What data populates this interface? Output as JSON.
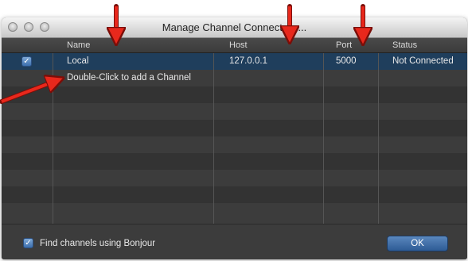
{
  "window": {
    "title": "Manage Channel Connect  s..."
  },
  "table": {
    "columns": {
      "name": "Name",
      "host": "Host",
      "port": "Port",
      "status": "Status"
    },
    "rows": [
      {
        "checked": "✓",
        "name": "Local",
        "host": "127.0.0.1",
        "port": "5000",
        "status": "Not Connected"
      },
      {
        "name": "Double-Click to add a Channel"
      }
    ]
  },
  "footer": {
    "bonjour_checked": "✓",
    "bonjour_label": "Find channels using Bonjour",
    "ok_label": "OK"
  },
  "colors": {
    "annotation_arrow": "#e8281c",
    "selected_row": "#1f3e5c",
    "ok_button": "#3a6aa6"
  },
  "icons": [
    "checkbox-icon",
    "close-traffic-light-icon",
    "minimize-traffic-light-icon",
    "zoom-traffic-light-icon",
    "annotation-arrow-icon"
  ]
}
